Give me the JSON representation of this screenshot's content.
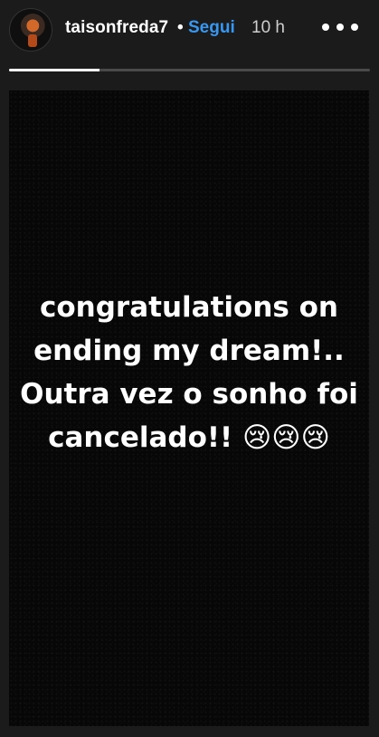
{
  "header": {
    "username": "taisonfreda7",
    "separator": "•",
    "follow_label": "Segui",
    "time": "10 h",
    "more_icon": "more-options-icon"
  },
  "progress": {
    "fraction": 0.25
  },
  "story": {
    "text_lines": [
      "congratulations on",
      "ending my dream!..",
      "Outra vez o sonho foi",
      "cancelado!! 😢😢😢"
    ]
  }
}
